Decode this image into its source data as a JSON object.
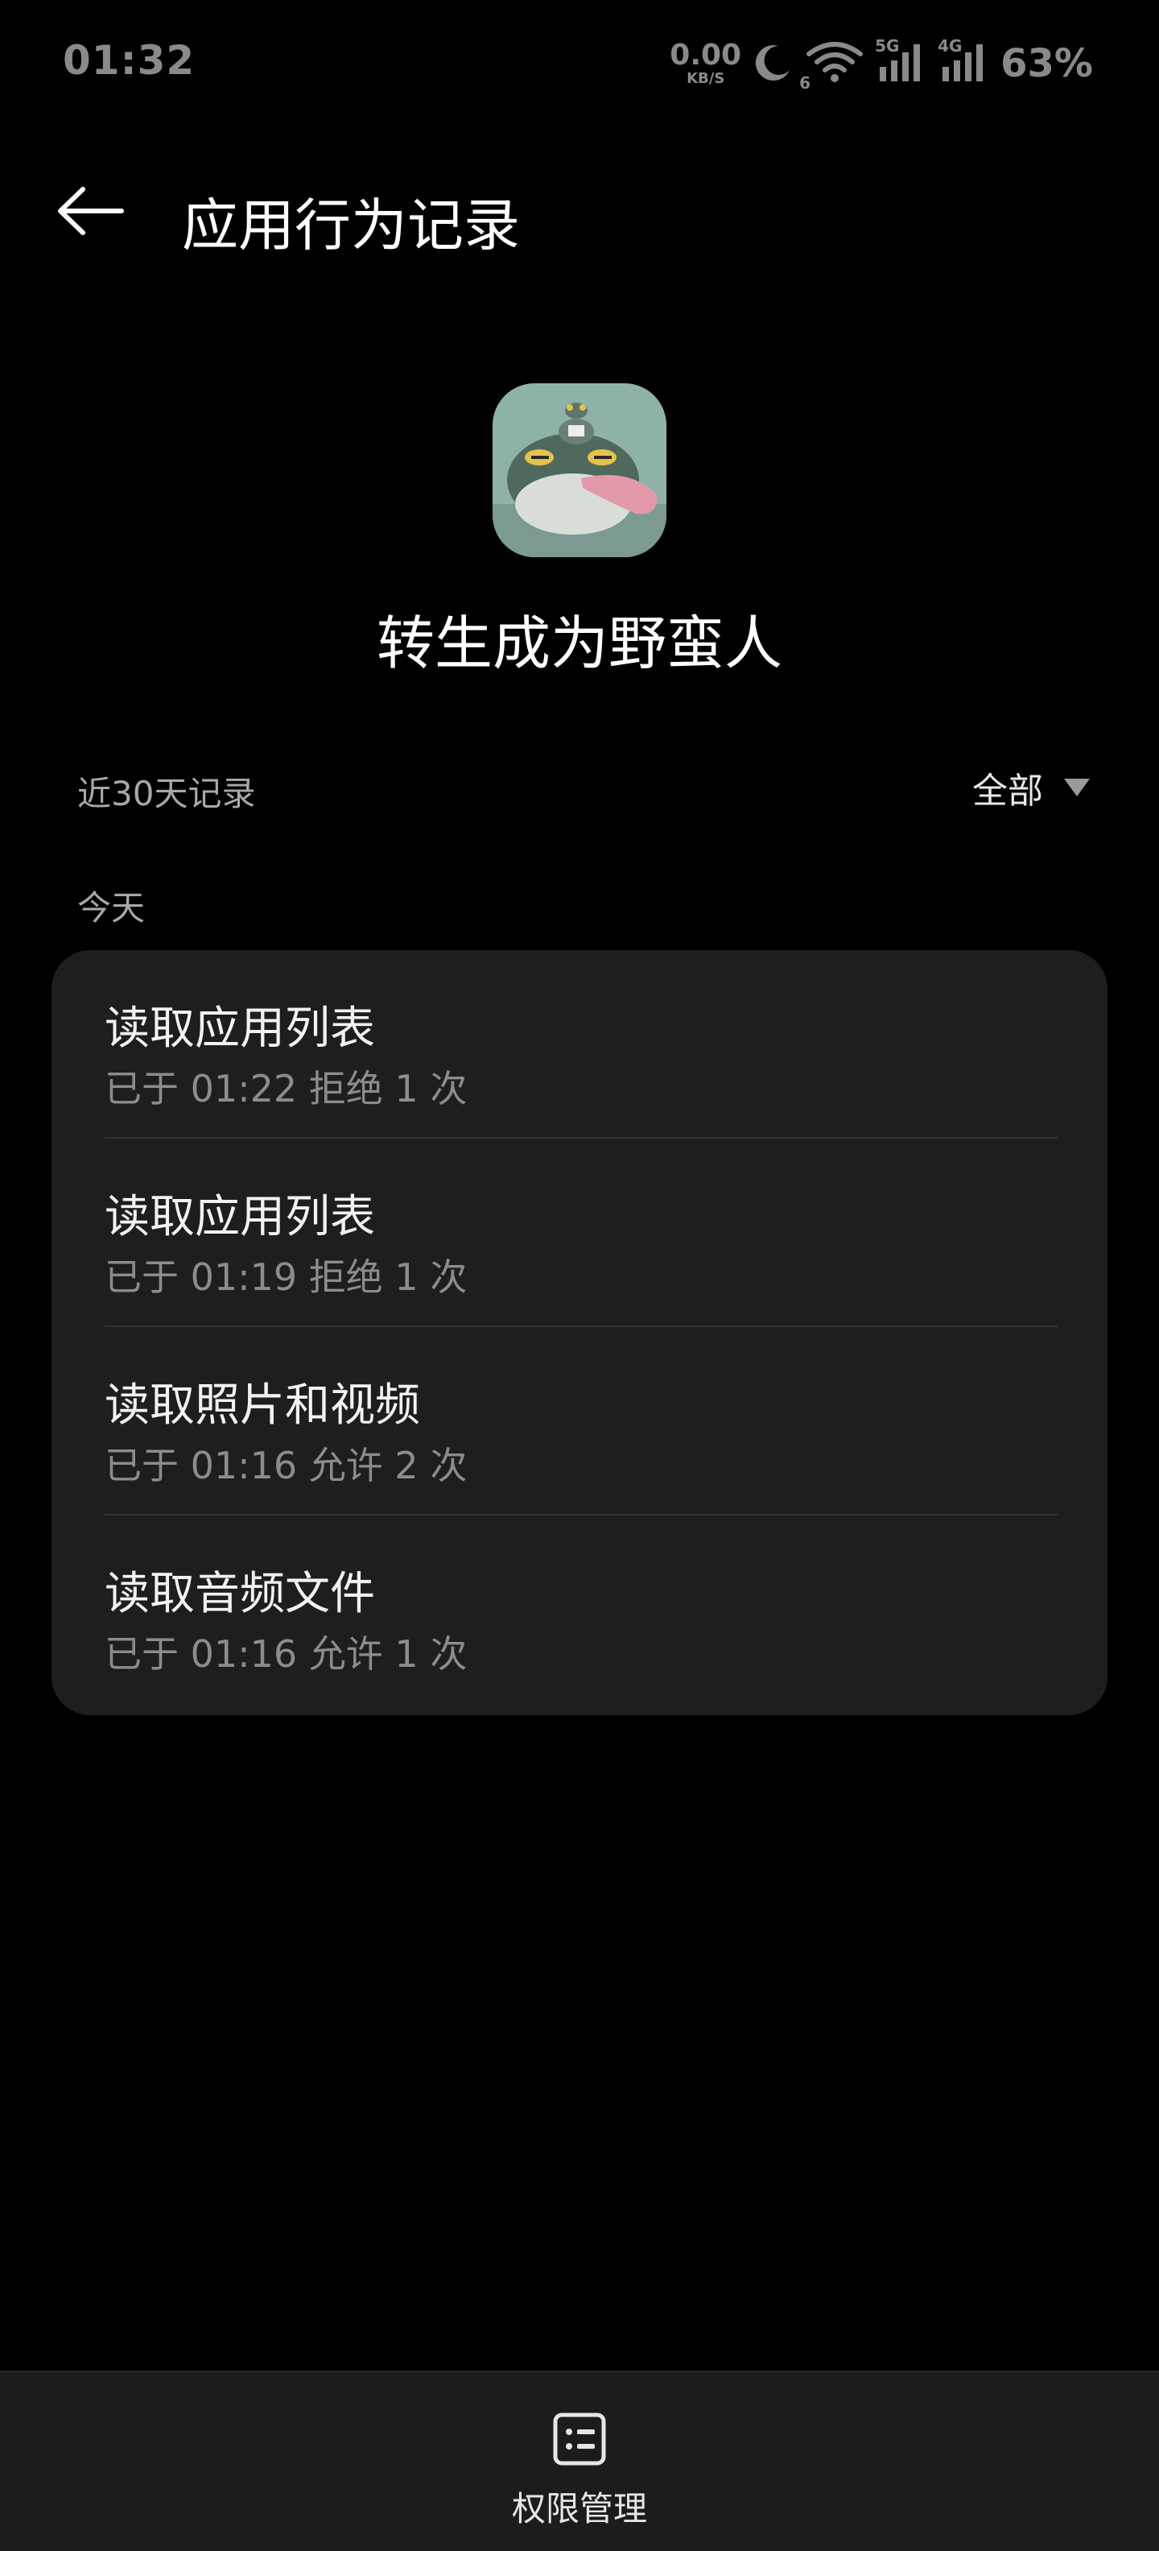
{
  "status_bar": {
    "time": "01:32",
    "net_speed_value": "0.00",
    "net_speed_unit": "KB/S",
    "wifi_badge": "6",
    "signal1_badge": "5G",
    "signal2_badge": "4G",
    "battery": "63%",
    "icons": [
      "moon-icon",
      "wifi-icon",
      "signal-icon",
      "signal-icon"
    ]
  },
  "header": {
    "back_icon": "arrow-left-icon",
    "title": "应用行为记录"
  },
  "app": {
    "name": "转生成为野蛮人"
  },
  "records": {
    "range_label": "近30天记录",
    "filter_label": "全部",
    "day_label": "今天",
    "items": [
      {
        "title": "读取应用列表",
        "detail": "已于 01:22 拒绝 1 次"
      },
      {
        "title": "读取应用列表",
        "detail": "已于 01:19 拒绝 1 次"
      },
      {
        "title": "读取照片和视频",
        "detail": "已于 01:16 允许 2 次"
      },
      {
        "title": "读取音频文件",
        "detail": "已于 01:16 允许 1 次"
      }
    ]
  },
  "bottom_bar": {
    "icon": "permission-list-icon",
    "label": "权限管理"
  },
  "colors": {
    "background": "#000000",
    "card": "#1e1e1e",
    "primary_text": "#ffffff",
    "secondary_text": "#8c8c8c"
  }
}
